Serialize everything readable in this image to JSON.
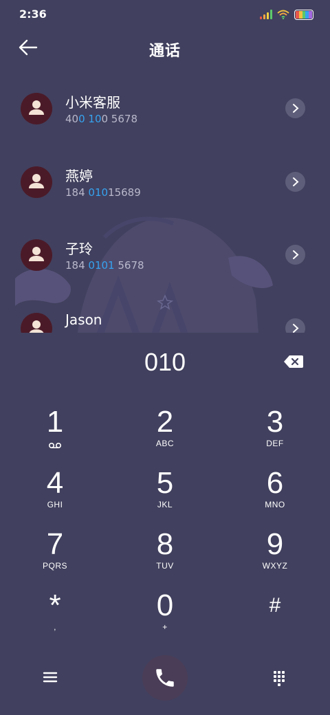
{
  "status_bar": {
    "time": "2:36"
  },
  "header": {
    "title": "通话",
    "back_icon": "arrow-left-icon"
  },
  "results": [
    {
      "name": "小米客服",
      "number_parts": [
        [
          "40",
          false
        ],
        [
          "0 10",
          true
        ],
        [
          "0 5678",
          false
        ]
      ],
      "number": "400 100 5678"
    },
    {
      "name": "燕婷",
      "number_parts": [
        [
          "184 ",
          false
        ],
        [
          "010",
          true
        ],
        [
          "15689",
          false
        ]
      ],
      "number": "184 01015689"
    },
    {
      "name": "子玲",
      "number_parts": [
        [
          "184 ",
          false
        ],
        [
          "0101",
          true
        ],
        [
          " 5678",
          false
        ]
      ],
      "number": "184 0101 5678"
    },
    {
      "name": "Jason",
      "number_parts": [],
      "number": ""
    }
  ],
  "dialer": {
    "number": "010",
    "backspace_icon": "backspace-icon"
  },
  "keypad": [
    {
      "digit": "1",
      "letters": "",
      "icon": "voicemail-icon"
    },
    {
      "digit": "2",
      "letters": "ABC"
    },
    {
      "digit": "3",
      "letters": "DEF"
    },
    {
      "digit": "4",
      "letters": "GHI"
    },
    {
      "digit": "5",
      "letters": "JKL"
    },
    {
      "digit": "6",
      "letters": "MNO"
    },
    {
      "digit": "7",
      "letters": "PQRS"
    },
    {
      "digit": "8",
      "letters": "TUV"
    },
    {
      "digit": "9",
      "letters": "WXYZ"
    },
    {
      "digit": "*",
      "letters": ","
    },
    {
      "digit": "0",
      "letters": "+"
    },
    {
      "digit": "#",
      "letters": ""
    }
  ],
  "bottom_bar": {
    "menu_icon": "menu-icon",
    "call_icon": "phone-icon",
    "dialpad_icon": "dialpad-icon"
  },
  "colors": {
    "background": "#41405e",
    "highlight": "#36a3f0",
    "avatar": "#4b1a28",
    "call_button": "#4a3d57"
  }
}
